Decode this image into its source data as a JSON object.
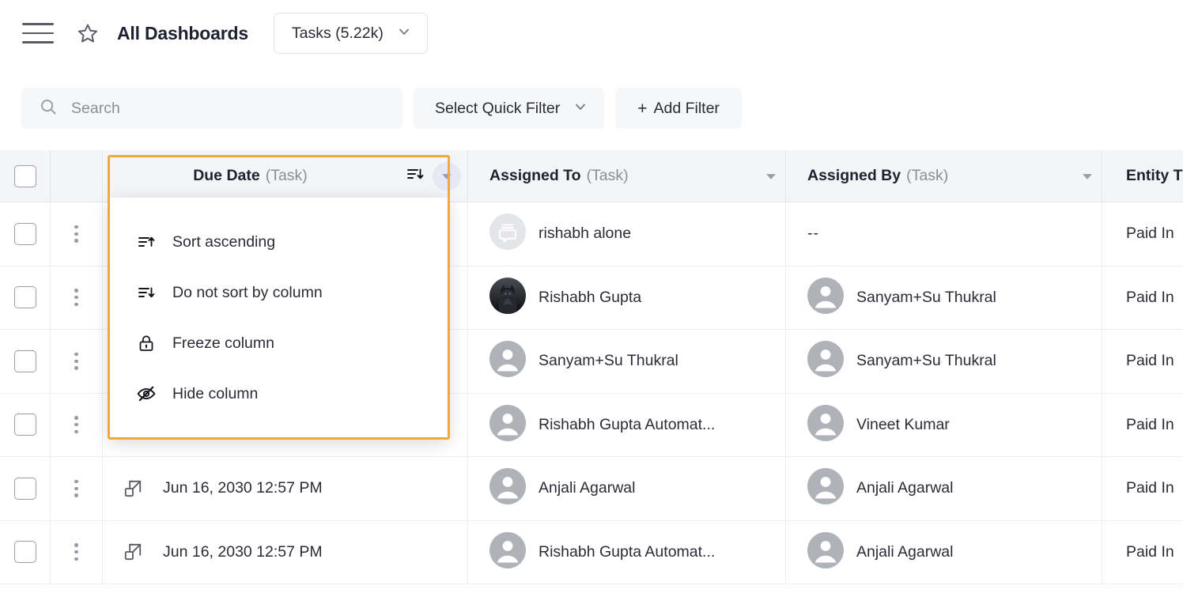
{
  "topbar": {
    "menu_icon": "hamburger-icon",
    "star_icon": "star-outline-icon",
    "title": "All Dashboards",
    "entity_select": {
      "label": "Tasks (5.22k)",
      "chevron_icon": "chevron-down-icon"
    }
  },
  "filterbar": {
    "search": {
      "placeholder": "Search",
      "value": "",
      "icon": "search-icon"
    },
    "quick_filter": {
      "label": "Select Quick Filter",
      "chevron_icon": "chevron-down-icon"
    },
    "add_filter": {
      "plus": "+",
      "label": "Add Filter"
    }
  },
  "table": {
    "select_all_checkbox": "unchecked",
    "columns": [
      {
        "title": "Due Date",
        "subtitle": "(Task)",
        "sort_icon": "sort-descending-icon",
        "menu_icon": "caret-down-icon",
        "menu_open": true
      },
      {
        "title": "Assigned To",
        "subtitle": "(Task)",
        "menu_icon": "caret-down-icon",
        "menu_open": false
      },
      {
        "title": "Assigned By",
        "subtitle": "(Task)",
        "menu_icon": "caret-down-icon",
        "menu_open": false
      },
      {
        "title": "Entity T",
        "subtitle": "",
        "menu_icon": "",
        "menu_open": false
      }
    ],
    "rows": [
      {
        "checkbox": "unchecked",
        "row_menu": "kebab-menu-icon",
        "expand": "",
        "due_date": "",
        "assigned_to": {
          "name": "rishabh alone",
          "avatar": "chat-bubble-icon"
        },
        "assigned_by": {
          "name": "--",
          "avatar": "none"
        },
        "entity_type": "Paid In"
      },
      {
        "checkbox": "unchecked",
        "row_menu": "kebab-menu-icon",
        "expand": "",
        "due_date": "",
        "assigned_to": {
          "name": "Rishabh Gupta",
          "avatar": "photo-batman"
        },
        "assigned_by": {
          "name": "Sanyam+Su Thukral",
          "avatar": "person-icon"
        },
        "entity_type": "Paid In"
      },
      {
        "checkbox": "unchecked",
        "row_menu": "kebab-menu-icon",
        "expand": "",
        "due_date": "",
        "assigned_to": {
          "name": "Sanyam+Su Thukral",
          "avatar": "person-icon"
        },
        "assigned_by": {
          "name": "Sanyam+Su Thukral",
          "avatar": "person-icon"
        },
        "entity_type": "Paid In"
      },
      {
        "checkbox": "unchecked",
        "row_menu": "kebab-menu-icon",
        "expand": "",
        "due_date": "",
        "assigned_to": {
          "name": "Rishabh Gupta Automat...",
          "avatar": "person-icon"
        },
        "assigned_by": {
          "name": "Vineet Kumar",
          "avatar": "person-icon"
        },
        "entity_type": "Paid In"
      },
      {
        "checkbox": "unchecked",
        "row_menu": "kebab-menu-icon",
        "expand": "open-in-new-icon",
        "due_date": "Jun 16, 2030 12:57 PM",
        "assigned_to": {
          "name": "Anjali Agarwal",
          "avatar": "person-icon"
        },
        "assigned_by": {
          "name": "Anjali Agarwal",
          "avatar": "person-icon"
        },
        "entity_type": "Paid In"
      },
      {
        "checkbox": "unchecked",
        "row_menu": "kebab-menu-icon",
        "expand": "open-in-new-icon",
        "due_date": "Jun 16, 2030 12:57 PM",
        "assigned_to": {
          "name": "Rishabh Gupta Automat...",
          "avatar": "person-icon"
        },
        "assigned_by": {
          "name": "Anjali Agarwal",
          "avatar": "person-icon"
        },
        "entity_type": "Paid In"
      }
    ]
  },
  "column_menu": {
    "highlight_color": "#f2a93b",
    "items": [
      {
        "label": "Sort ascending",
        "icon": "sort-ascending-icon"
      },
      {
        "label": "Do not sort by column",
        "icon": "sort-descending-icon"
      },
      {
        "label": "Freeze column",
        "icon": "lock-icon"
      },
      {
        "label": "Hide column",
        "icon": "eye-off-icon"
      }
    ]
  },
  "colors": {
    "accent": "#f2a93b",
    "header_bg": "#f4f5f7",
    "border": "#eceef1",
    "muted_text": "#8b8d98"
  }
}
